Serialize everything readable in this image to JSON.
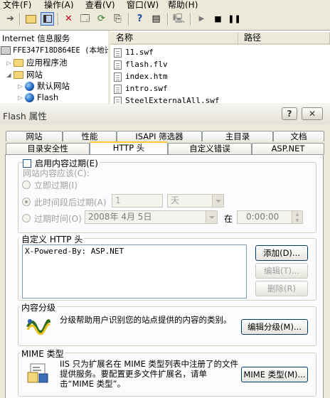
{
  "menu": [
    "文件(F)",
    "操作(A)",
    "查看(V)",
    "窗口(W)",
    "帮助(H)"
  ],
  "tree": {
    "root": "Internet 信息服务",
    "computer": "FFE347F18D864EE (本地计",
    "app_pools": "应用程序池",
    "websites": "网站",
    "default_site": "默认网站",
    "flash": "Flash"
  },
  "list": {
    "col_name": "名称",
    "col_path": "路径",
    "files": [
      "11.swf",
      "flash.flv",
      "index.htm",
      "intro.swf",
      "SteelExternalAll.swf"
    ]
  },
  "dialog": {
    "title": "Flash 属性",
    "help_btn": "?",
    "close_btn": "✕",
    "tabs_row1": [
      "网站",
      "性能",
      "ISAPI 筛选器",
      "主目录",
      "文档"
    ],
    "tabs_row2": [
      "目录安全性",
      "HTTP 头",
      "自定义错误",
      "ASP.NET"
    ],
    "active_tab": "HTTP 头"
  },
  "expire": {
    "enable_label": "启用内容过期(E)",
    "content_should": "网站内容应该(C):",
    "immediate": "立即过期(I)",
    "after": "此时间段后过期(A)",
    "after_value": "1",
    "unit": "天",
    "on": "过期时间(O)",
    "date": "2008年 4月 5日",
    "at": "在",
    "time": "0:00:00"
  },
  "custom_headers": {
    "title": "自定义 HTTP 头",
    "entries": [
      "X-Powered-By: ASP.NET"
    ],
    "add": "添加(D)...",
    "edit": "编辑(T)...",
    "delete": "删除(R)"
  },
  "rating": {
    "title": "内容分级",
    "desc": "分级帮助用户识别您的站点提供的内容的类别。",
    "button": "编辑分级(M)..."
  },
  "mime": {
    "title": "MIME 类型",
    "desc": "IIS 只为扩展名在 MIME 类型列表中注册了的文件提供服务。要配置更多文件扩展名，请单击“MIME 类型”。",
    "button": "MIME 类型(M)..."
  }
}
